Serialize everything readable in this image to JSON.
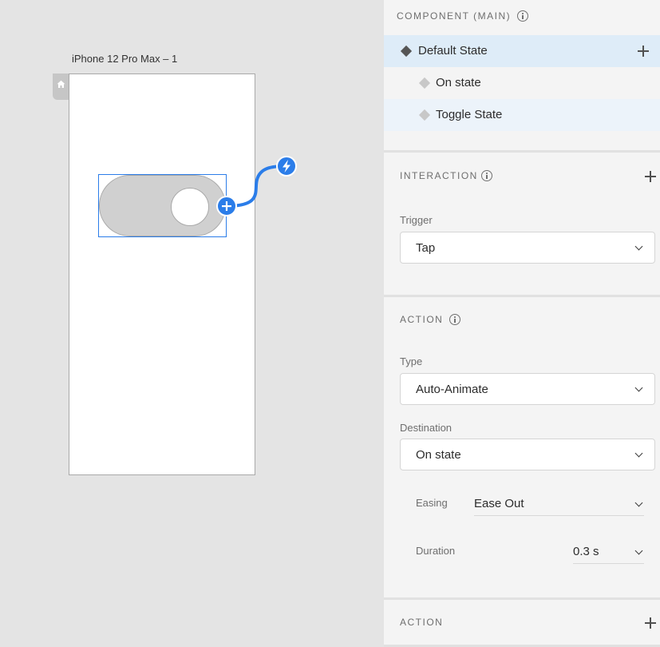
{
  "canvas": {
    "artboard_title": "iPhone 12 Pro Max – 1"
  },
  "component": {
    "section_title": "COMPONENT (MAIN)",
    "states": [
      {
        "label": "Default State",
        "selected": true
      },
      {
        "label": "On state",
        "selected": false
      },
      {
        "label": "Toggle State",
        "selected": false
      }
    ]
  },
  "interaction": {
    "section_title": "INTERACTION",
    "trigger_label": "Trigger",
    "trigger_value": "Tap"
  },
  "action": {
    "section_title": "ACTION",
    "type_label": "Type",
    "type_value": "Auto-Animate",
    "destination_label": "Destination",
    "destination_value": "On state",
    "easing_label": "Easing",
    "easing_value": "Ease Out",
    "duration_label": "Duration",
    "duration_value": "0.3 s"
  },
  "action2": {
    "section_title": "ACTION"
  },
  "colors": {
    "accent": "#2b7de9",
    "selected_row": "#deecf8",
    "toggle_fill": "#d0d0d0"
  }
}
